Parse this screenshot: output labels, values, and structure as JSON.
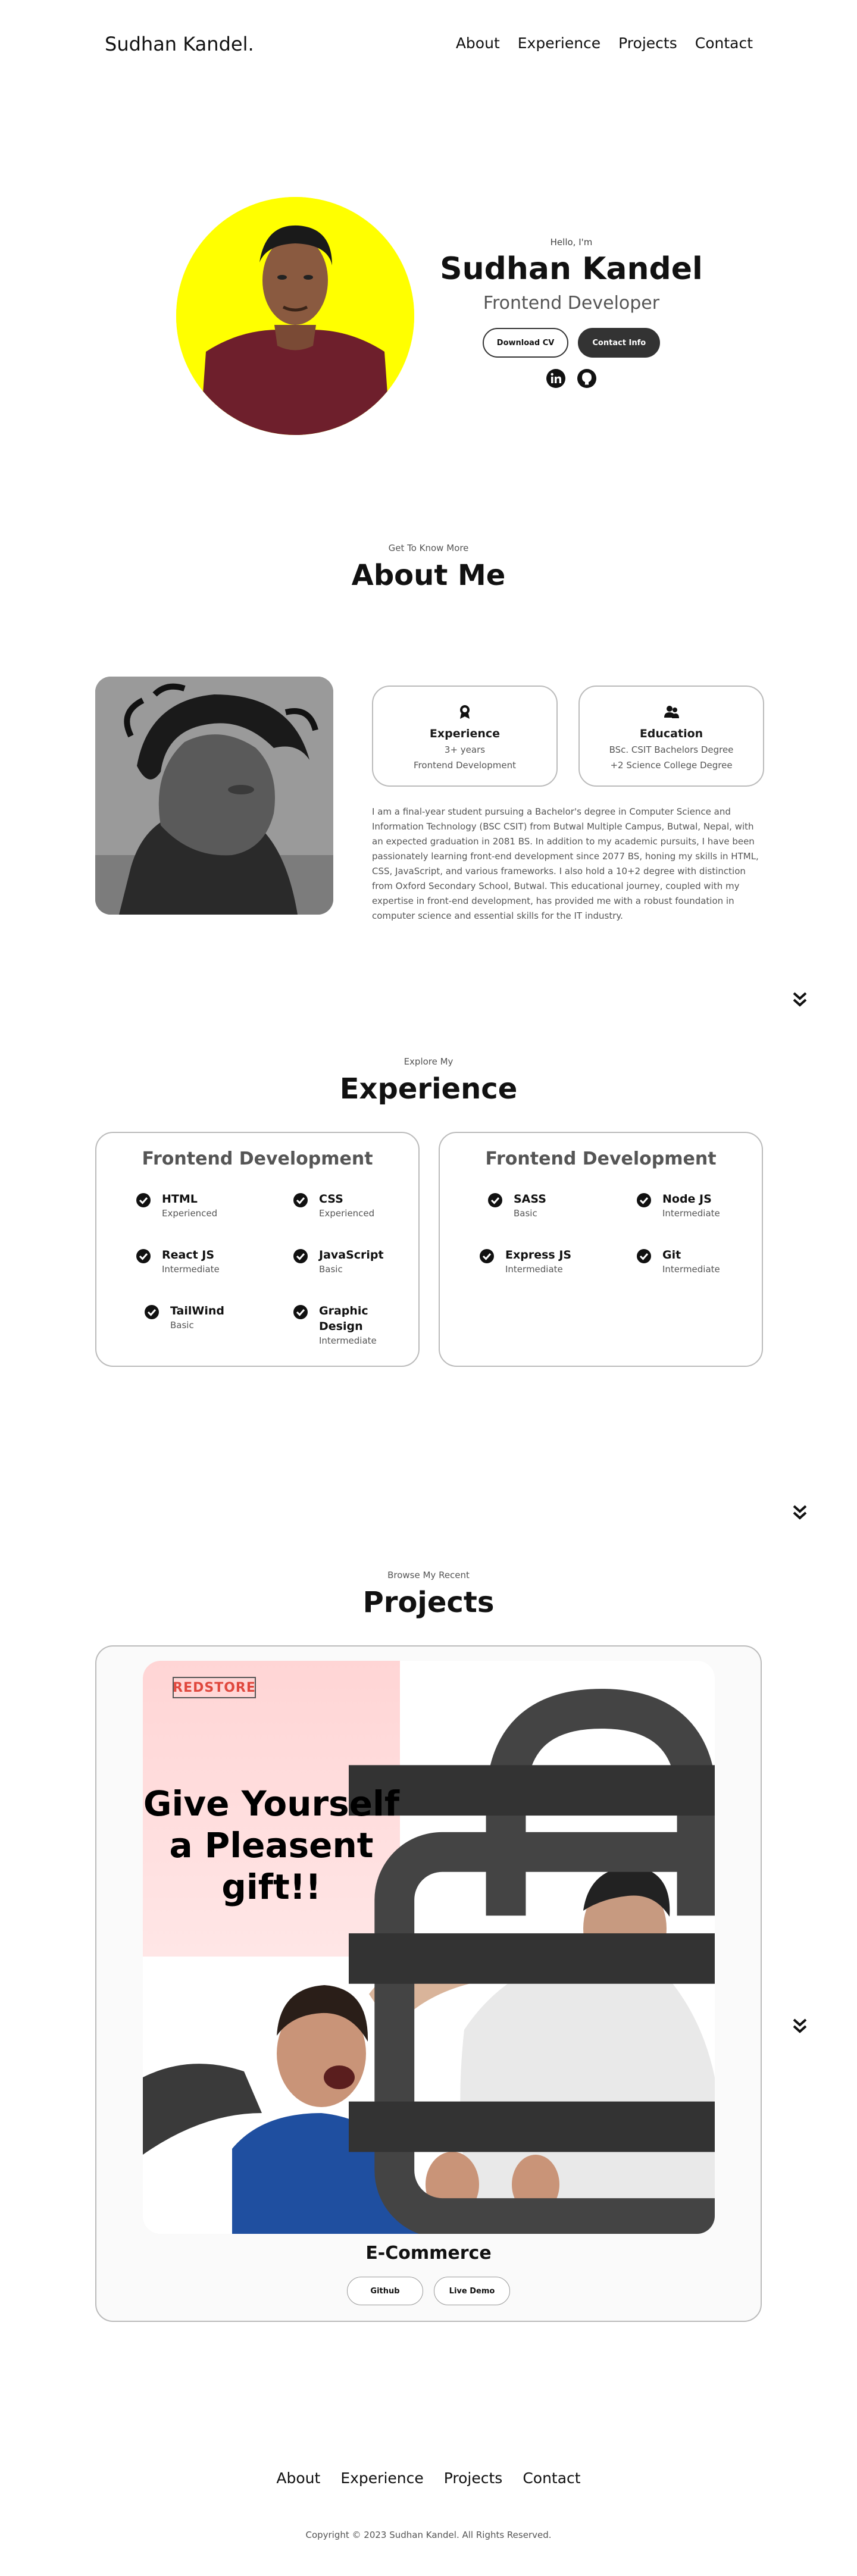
{
  "nav": {
    "logo": "Sudhan Kandel.",
    "links": [
      "About",
      "Experience",
      "Projects",
      "Contact"
    ]
  },
  "hero": {
    "greeting": "Hello, I'm",
    "name": "Sudhan Kandel",
    "role": "Frontend Developer",
    "download_cv": "Download CV",
    "contact_info": "Contact Info",
    "socials": [
      "linkedin-icon",
      "github-icon"
    ],
    "photo_bg": "#ffff00"
  },
  "about": {
    "subtitle": "Get To Know More",
    "title": "About Me",
    "cards": [
      {
        "icon": "medal-icon",
        "title": "Experience",
        "lines": [
          "3+ years",
          "Frontend Development"
        ]
      },
      {
        "icon": "graduation-icon",
        "title": "Education",
        "lines": [
          "BSc. CSIT Bachelors Degree",
          "+2 Science College Degree"
        ]
      }
    ],
    "text": "I am a final-year student pursuing a Bachelor's degree in Computer Science and Information Technology (BSC CSIT) from Butwal Multiple Campus, Butwal, Nepal, with an expected graduation in 2081 BS. In addition to my academic pursuits, I have been passionately learning front-end development since 2077 BS, honing my skills in HTML, CSS, JavaScript, and various frameworks. I also hold a 10+2 degree with distinction from Oxford Secondary School, Butwal. This educational journey, coupled with my expertise in front-end development, has provided me with a robust foundation in computer science and essential skills for the IT industry."
  },
  "experience": {
    "subtitle": "Explore My",
    "title": "Experience",
    "cards": [
      {
        "title": "Frontend Development",
        "skills": [
          {
            "name": "HTML",
            "level": "Experienced"
          },
          {
            "name": "CSS",
            "level": "Experienced"
          },
          {
            "name": "React JS",
            "level": "Intermediate"
          },
          {
            "name": "JavaScript",
            "level": "Basic"
          },
          {
            "name": "TailWind",
            "level": "Basic"
          },
          {
            "name": "Graphic Design",
            "level": "Intermediate"
          }
        ]
      },
      {
        "title": "Frontend Development",
        "skills": [
          {
            "name": "SASS",
            "level": "Basic"
          },
          {
            "name": "Node JS",
            "level": "Intermediate"
          },
          {
            "name": "Express JS",
            "level": "Intermediate"
          },
          {
            "name": "Git",
            "level": "Intermediate"
          }
        ]
      }
    ]
  },
  "projects": {
    "subtitle": "Browse My Recent",
    "title": "Projects",
    "items": [
      {
        "title": "E-Commerce",
        "brand": "REDSTORE",
        "headline": "Give Yourself a Pleasent gift!!",
        "buttons": [
          "Github",
          "Live Demo"
        ]
      }
    ]
  },
  "footer": {
    "links": [
      "About",
      "Experience",
      "Projects",
      "Contact"
    ],
    "copyright": "Copyright © 2023 Sudhan Kandel. All Rights Reserved."
  }
}
